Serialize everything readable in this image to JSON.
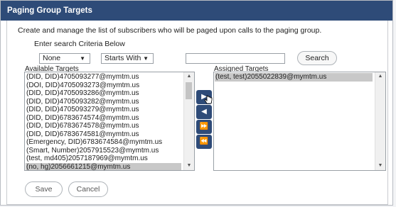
{
  "dialog": {
    "title": "Paging Group Targets"
  },
  "description": "Create and manage the list of subscribers who will be paged upon calls to the paging group.",
  "criteria_label": "Enter search Criteria Below",
  "search": {
    "field_value": "None",
    "match_value": "Starts With",
    "text_value": "",
    "button_label": "Search"
  },
  "available": {
    "label": "Available Targets",
    "items": [
      "(DID, DID)4705093277@mymtm.us",
      "(DOI, DID)4705093273@mymtm.us",
      "(DID, DID)4705093286@mymtm.us",
      "(DID, DID)4705093282@mymtm.us",
      "(DID, DID)4705093279@mymtm.us",
      "(DID, DID)6783674574@mymtm.us",
      "(DID, DID)6783674578@mymtm.us",
      "(DID, DID)6783674581@mymtm.us",
      "(Emergency, DID)6783674584@mymtm.us",
      "(Smart, Number)2057915523@mymtm.us",
      "(test, md405)2057187969@mymtm.us",
      "(no, hg)2056661215@mymtm.us"
    ],
    "selected_index": 11
  },
  "assigned": {
    "label": "Assigned Targets",
    "items": [
      "(test, test)2055022839@mymtm.us"
    ],
    "selected_index": 0
  },
  "move_buttons": [
    {
      "name": "move-right-button",
      "glyph": "▶"
    },
    {
      "name": "move-left-button",
      "glyph": "◀"
    },
    {
      "name": "move-all-right-button",
      "glyph": "⏩"
    },
    {
      "name": "move-all-left-button",
      "glyph": "⏪"
    }
  ],
  "footer": {
    "save_label": "Save",
    "cancel_label": "Cancel"
  },
  "colors": {
    "titlebar": "#2e4b78",
    "button": "#2e4b78",
    "selection": "#c8c8c8"
  }
}
